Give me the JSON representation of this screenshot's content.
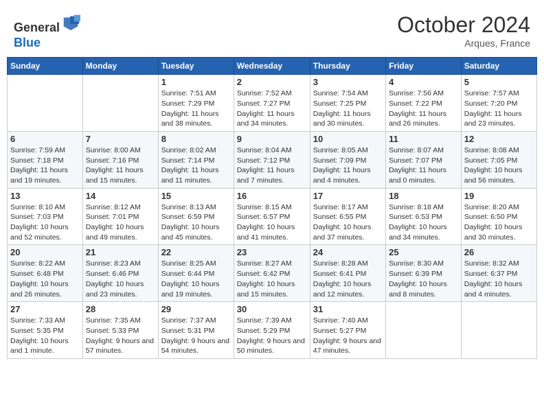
{
  "header": {
    "logo_line1": "General",
    "logo_line2": "Blue",
    "month": "October 2024",
    "location": "Arques, France"
  },
  "weekdays": [
    "Sunday",
    "Monday",
    "Tuesday",
    "Wednesday",
    "Thursday",
    "Friday",
    "Saturday"
  ],
  "weeks": [
    [
      {
        "day": "",
        "info": ""
      },
      {
        "day": "",
        "info": ""
      },
      {
        "day": "1",
        "info": "Sunrise: 7:51 AM\nSunset: 7:29 PM\nDaylight: 11 hours and 38 minutes."
      },
      {
        "day": "2",
        "info": "Sunrise: 7:52 AM\nSunset: 7:27 PM\nDaylight: 11 hours and 34 minutes."
      },
      {
        "day": "3",
        "info": "Sunrise: 7:54 AM\nSunset: 7:25 PM\nDaylight: 11 hours and 30 minutes."
      },
      {
        "day": "4",
        "info": "Sunrise: 7:56 AM\nSunset: 7:22 PM\nDaylight: 11 hours and 26 minutes."
      },
      {
        "day": "5",
        "info": "Sunrise: 7:57 AM\nSunset: 7:20 PM\nDaylight: 11 hours and 23 minutes."
      }
    ],
    [
      {
        "day": "6",
        "info": "Sunrise: 7:59 AM\nSunset: 7:18 PM\nDaylight: 11 hours and 19 minutes."
      },
      {
        "day": "7",
        "info": "Sunrise: 8:00 AM\nSunset: 7:16 PM\nDaylight: 11 hours and 15 minutes."
      },
      {
        "day": "8",
        "info": "Sunrise: 8:02 AM\nSunset: 7:14 PM\nDaylight: 11 hours and 11 minutes."
      },
      {
        "day": "9",
        "info": "Sunrise: 8:04 AM\nSunset: 7:12 PM\nDaylight: 11 hours and 7 minutes."
      },
      {
        "day": "10",
        "info": "Sunrise: 8:05 AM\nSunset: 7:09 PM\nDaylight: 11 hours and 4 minutes."
      },
      {
        "day": "11",
        "info": "Sunrise: 8:07 AM\nSunset: 7:07 PM\nDaylight: 11 hours and 0 minutes."
      },
      {
        "day": "12",
        "info": "Sunrise: 8:08 AM\nSunset: 7:05 PM\nDaylight: 10 hours and 56 minutes."
      }
    ],
    [
      {
        "day": "13",
        "info": "Sunrise: 8:10 AM\nSunset: 7:03 PM\nDaylight: 10 hours and 52 minutes."
      },
      {
        "day": "14",
        "info": "Sunrise: 8:12 AM\nSunset: 7:01 PM\nDaylight: 10 hours and 49 minutes."
      },
      {
        "day": "15",
        "info": "Sunrise: 8:13 AM\nSunset: 6:59 PM\nDaylight: 10 hours and 45 minutes."
      },
      {
        "day": "16",
        "info": "Sunrise: 8:15 AM\nSunset: 6:57 PM\nDaylight: 10 hours and 41 minutes."
      },
      {
        "day": "17",
        "info": "Sunrise: 8:17 AM\nSunset: 6:55 PM\nDaylight: 10 hours and 37 minutes."
      },
      {
        "day": "18",
        "info": "Sunrise: 8:18 AM\nSunset: 6:53 PM\nDaylight: 10 hours and 34 minutes."
      },
      {
        "day": "19",
        "info": "Sunrise: 8:20 AM\nSunset: 6:50 PM\nDaylight: 10 hours and 30 minutes."
      }
    ],
    [
      {
        "day": "20",
        "info": "Sunrise: 8:22 AM\nSunset: 6:48 PM\nDaylight: 10 hours and 26 minutes."
      },
      {
        "day": "21",
        "info": "Sunrise: 8:23 AM\nSunset: 6:46 PM\nDaylight: 10 hours and 23 minutes."
      },
      {
        "day": "22",
        "info": "Sunrise: 8:25 AM\nSunset: 6:44 PM\nDaylight: 10 hours and 19 minutes."
      },
      {
        "day": "23",
        "info": "Sunrise: 8:27 AM\nSunset: 6:42 PM\nDaylight: 10 hours and 15 minutes."
      },
      {
        "day": "24",
        "info": "Sunrise: 8:28 AM\nSunset: 6:41 PM\nDaylight: 10 hours and 12 minutes."
      },
      {
        "day": "25",
        "info": "Sunrise: 8:30 AM\nSunset: 6:39 PM\nDaylight: 10 hours and 8 minutes."
      },
      {
        "day": "26",
        "info": "Sunrise: 8:32 AM\nSunset: 6:37 PM\nDaylight: 10 hours and 4 minutes."
      }
    ],
    [
      {
        "day": "27",
        "info": "Sunrise: 7:33 AM\nSunset: 5:35 PM\nDaylight: 10 hours and 1 minute."
      },
      {
        "day": "28",
        "info": "Sunrise: 7:35 AM\nSunset: 5:33 PM\nDaylight: 9 hours and 57 minutes."
      },
      {
        "day": "29",
        "info": "Sunrise: 7:37 AM\nSunset: 5:31 PM\nDaylight: 9 hours and 54 minutes."
      },
      {
        "day": "30",
        "info": "Sunrise: 7:39 AM\nSunset: 5:29 PM\nDaylight: 9 hours and 50 minutes."
      },
      {
        "day": "31",
        "info": "Sunrise: 7:40 AM\nSunset: 5:27 PM\nDaylight: 9 hours and 47 minutes."
      },
      {
        "day": "",
        "info": ""
      },
      {
        "day": "",
        "info": ""
      }
    ]
  ]
}
